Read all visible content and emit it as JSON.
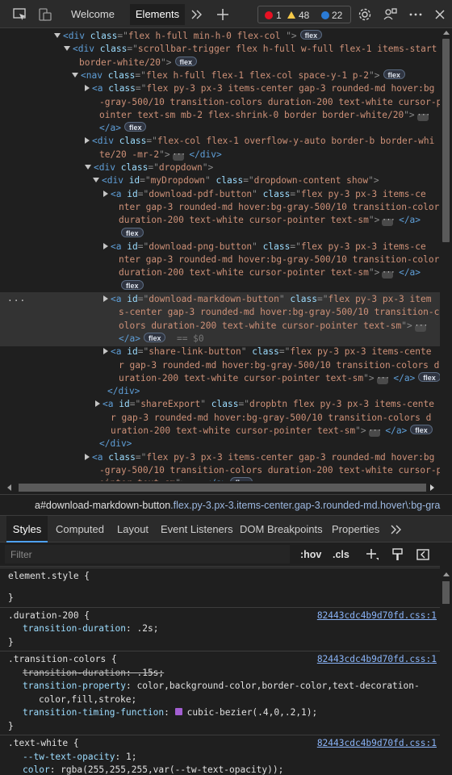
{
  "toolbar": {
    "tabs": [
      "Welcome",
      "Elements"
    ],
    "errors": "1",
    "warnings": "48",
    "issues": "22",
    "icons": [
      "inspect-icon",
      "device-toggle-icon",
      "more-tabs-icon",
      "add-tab-icon",
      "settings-icon",
      "customize-icon",
      "more-options-icon",
      "close-icon"
    ]
  },
  "tree": {
    "lines": [
      {
        "indent": 76,
        "arrow": "open",
        "parts": [
          [
            "tg",
            "<div "
          ],
          [
            "at",
            "class"
          ],
          [
            "pn",
            "=\""
          ],
          [
            "av",
            "flex h-full min-h-0 flex-col "
          ],
          [
            "pn",
            "\">"
          ]
        ],
        "badge": "flex"
      },
      {
        "indent": 88,
        "arrow": "open",
        "parts": [
          [
            "tg",
            "<div "
          ],
          [
            "at",
            "class"
          ],
          [
            "pn",
            "=\""
          ],
          [
            "av",
            "scrollbar-trigger flex h-full w-full flex-1 items-start"
          ]
        ]
      },
      {
        "indent": 98,
        "arrow": "",
        "parts": [
          [
            "av",
            "border-white/20"
          ],
          [
            "pn",
            "\">"
          ]
        ],
        "badge": "flex"
      },
      {
        "indent": 98,
        "arrow": "open",
        "parts": [
          [
            "tg",
            "<nav "
          ],
          [
            "at",
            "class"
          ],
          [
            "pn",
            "=\""
          ],
          [
            "av",
            "flex h-full flex-1 flex-col space-y-1 p-2"
          ],
          [
            "pn",
            "\">"
          ]
        ],
        "badge": "flex"
      },
      {
        "indent": 114,
        "arrow": "closed",
        "parts": [
          [
            "tg",
            "<a "
          ],
          [
            "at",
            "class"
          ],
          [
            "pn",
            "=\""
          ],
          [
            "av",
            "flex py-3 px-3 items-center gap-3 rounded-md hover:bg"
          ]
        ]
      },
      {
        "indent": 123,
        "arrow": "",
        "parts": [
          [
            "av",
            "-gray-500/10 transition-colors duration-200 text-white cursor-p"
          ]
        ]
      },
      {
        "indent": 123,
        "arrow": "",
        "parts": [
          [
            "av",
            "ointer text-sm mb-2 flex-shrink-0 border border-white/20"
          ],
          [
            "pn",
            "\">"
          ]
        ],
        "ell": true
      },
      {
        "indent": 123,
        "arrow": "",
        "parts": [
          [
            "tg",
            "</a>"
          ]
        ],
        "badge": "flex"
      },
      {
        "indent": 114,
        "arrow": "closed",
        "parts": [
          [
            "tg",
            "<div "
          ],
          [
            "at",
            "class"
          ],
          [
            "pn",
            "=\""
          ],
          [
            "av",
            "flex-col flex-1 overflow-y-auto border-b border-whi"
          ]
        ]
      },
      {
        "indent": 123,
        "arrow": "",
        "parts": [
          [
            "av",
            "te/20 -mr-2"
          ],
          [
            "pn",
            "\">"
          ]
        ],
        "ell": true,
        "after": [
          [
            "tg",
            "</div>"
          ]
        ]
      },
      {
        "indent": 114,
        "arrow": "open",
        "parts": [
          [
            "tg",
            "<div "
          ],
          [
            "at",
            "class"
          ],
          [
            "pn",
            "=\""
          ],
          [
            "av",
            "dropdown"
          ],
          [
            "pn",
            "\">"
          ]
        ]
      },
      {
        "indent": 124,
        "arrow": "open",
        "parts": [
          [
            "tg",
            "<div "
          ],
          [
            "at",
            "id"
          ],
          [
            "pn",
            "=\""
          ],
          [
            "av",
            "myDropdown"
          ],
          [
            "pn",
            "\" "
          ],
          [
            "at",
            "class"
          ],
          [
            "pn",
            "=\""
          ],
          [
            "av",
            "dropdown-content show"
          ],
          [
            "pn",
            "\">"
          ]
        ]
      },
      {
        "indent": 137,
        "arrow": "closed",
        "parts": [
          [
            "tg",
            "<a "
          ],
          [
            "at",
            "id"
          ],
          [
            "pn",
            "=\""
          ],
          [
            "av",
            "download-pdf-button"
          ],
          [
            "pn",
            "\" "
          ],
          [
            "at",
            "class"
          ],
          [
            "pn",
            "=\""
          ],
          [
            "av",
            "flex py-3 px-3 items-ce"
          ]
        ]
      },
      {
        "indent": 147,
        "arrow": "",
        "parts": [
          [
            "av",
            "nter gap-3 rounded-md hover:bg-gray-500/10 transition-colors"
          ]
        ]
      },
      {
        "indent": 147,
        "arrow": "",
        "parts": [
          [
            "av",
            "duration-200 text-white cursor-pointer text-sm"
          ],
          [
            "pn",
            "\">"
          ]
        ],
        "ell": true,
        "after": [
          [
            "tg",
            "</a>"
          ]
        ]
      },
      {
        "indent": 147,
        "arrow": "",
        "parts": [],
        "badge": "flex"
      },
      {
        "indent": 137,
        "arrow": "closed",
        "parts": [
          [
            "tg",
            "<a "
          ],
          [
            "at",
            "id"
          ],
          [
            "pn",
            "=\""
          ],
          [
            "av",
            "download-png-button"
          ],
          [
            "pn",
            "\" "
          ],
          [
            "at",
            "class"
          ],
          [
            "pn",
            "=\""
          ],
          [
            "av",
            "flex py-3 px-3 items-ce"
          ]
        ]
      },
      {
        "indent": 147,
        "arrow": "",
        "parts": [
          [
            "av",
            "nter gap-3 rounded-md hover:bg-gray-500/10 transition-colors"
          ]
        ]
      },
      {
        "indent": 147,
        "arrow": "",
        "parts": [
          [
            "av",
            "duration-200 text-white cursor-pointer text-sm"
          ],
          [
            "pn",
            "\">"
          ]
        ],
        "ell": true,
        "after": [
          [
            "tg",
            "</a>"
          ]
        ]
      },
      {
        "indent": 147,
        "arrow": "",
        "parts": [],
        "badge": "flex"
      },
      {
        "indent": 137,
        "arrow": "closed",
        "selected": true,
        "parts": [
          [
            "tg",
            "<a "
          ],
          [
            "at",
            "id"
          ],
          [
            "pn",
            "=\""
          ],
          [
            "av",
            "download-markdown-button"
          ],
          [
            "pn",
            "\" "
          ],
          [
            "at",
            "class"
          ],
          [
            "pn",
            "=\""
          ],
          [
            "av",
            "flex py-3 px-3 item"
          ]
        ]
      },
      {
        "indent": 147,
        "arrow": "",
        "selected": true,
        "parts": [
          [
            "av",
            "s-center gap-3 rounded-md hover:bg-gray-500/10 transition-c"
          ]
        ]
      },
      {
        "indent": 147,
        "arrow": "",
        "selected": true,
        "parts": [
          [
            "av",
            "olors duration-200 text-white cursor-pointer text-sm"
          ],
          [
            "pn",
            "\">"
          ]
        ],
        "ell": true
      },
      {
        "indent": 147,
        "arrow": "",
        "selected": true,
        "parts": [
          [
            "tg",
            "</a>"
          ]
        ],
        "badge": "flex",
        "after": [
          [
            "dollar",
            " == $0"
          ]
        ]
      },
      {
        "indent": 137,
        "arrow": "closed",
        "parts": [
          [
            "tg",
            "<a "
          ],
          [
            "at",
            "id"
          ],
          [
            "pn",
            "=\""
          ],
          [
            "av",
            "share-link-button"
          ],
          [
            "pn",
            "\" "
          ],
          [
            "at",
            "class"
          ],
          [
            "pn",
            "=\""
          ],
          [
            "av",
            "flex py-3 px-3 items-cente"
          ]
        ]
      },
      {
        "indent": 147,
        "arrow": "",
        "parts": [
          [
            "av",
            "r gap-3 rounded-md hover:bg-gray-500/10 transition-colors d"
          ]
        ]
      },
      {
        "indent": 147,
        "arrow": "",
        "parts": [
          [
            "av",
            "uration-200 text-white cursor-pointer text-sm"
          ],
          [
            "pn",
            "\">"
          ]
        ],
        "ell": true,
        "after": [
          [
            "tg",
            "</a>"
          ]
        ],
        "badge2": "flex"
      },
      {
        "indent": 133,
        "arrow": "",
        "parts": [
          [
            "tg",
            "</div>"
          ]
        ]
      },
      {
        "indent": 127,
        "arrow": "closed",
        "parts": [
          [
            "tg",
            "<a "
          ],
          [
            "at",
            "id"
          ],
          [
            "pn",
            "=\""
          ],
          [
            "av",
            "shareExport"
          ],
          [
            "pn",
            "\" "
          ],
          [
            "at",
            "class"
          ],
          [
            "pn",
            "=\""
          ],
          [
            "av",
            "dropbtn flex py-3 px-3 items-cente"
          ]
        ]
      },
      {
        "indent": 137,
        "arrow": "",
        "parts": [
          [
            "av",
            "r gap-3 rounded-md hover:bg-gray-500/10 transition-colors d"
          ]
        ]
      },
      {
        "indent": 137,
        "arrow": "",
        "parts": [
          [
            "av",
            "uration-200 text-white cursor-pointer text-sm"
          ],
          [
            "pn",
            "\">"
          ]
        ],
        "ell": true,
        "after": [
          [
            "tg",
            "</a>"
          ]
        ],
        "badge2": "flex"
      },
      {
        "indent": 123,
        "arrow": "",
        "parts": [
          [
            "tg",
            "</div>"
          ]
        ]
      },
      {
        "indent": 114,
        "arrow": "closed",
        "parts": [
          [
            "tg",
            "<a "
          ],
          [
            "at",
            "class"
          ],
          [
            "pn",
            "=\""
          ],
          [
            "av",
            "flex py-3 px-3 items-center gap-3 rounded-md hover:bg"
          ]
        ]
      },
      {
        "indent": 123,
        "arrow": "",
        "parts": [
          [
            "av",
            "-gray-500/10 transition-colors duration-200 text-white cursor-p"
          ]
        ]
      },
      {
        "indent": 123,
        "arrow": "",
        "parts": [
          [
            "av",
            "ointer text-sm"
          ],
          [
            "pn",
            "\">"
          ]
        ],
        "ell": true,
        "after": [
          [
            "tg",
            "</a>"
          ]
        ],
        "badge2": "flex"
      }
    ]
  },
  "breadcrumb": {
    "main": "a#download-markdown-button",
    "classes": ".flex.py-3.px-3.items-center.gap-3.rounded-md.hover\\:bg-gra"
  },
  "styles_tabs": [
    "Styles",
    "Computed",
    "Layout",
    "Event Listeners",
    "DOM Breakpoints",
    "Properties"
  ],
  "filter": {
    "placeholder": "Filter",
    "hov": ":hov",
    "cls": ".cls"
  },
  "rules": [
    {
      "selector": "element.style {",
      "source": "",
      "decls": [],
      "close": "}"
    },
    {
      "selector": ".duration-200 {",
      "source": "82443cdc4b9d70fd.css:1",
      "decls": [
        {
          "p": "transition-duration",
          "v": ".2s"
        }
      ],
      "close": "}"
    },
    {
      "selector": ".transition-colors {",
      "source": "82443cdc4b9d70fd.css:1",
      "decls": [
        {
          "p": "transition-duration",
          "v": ".15s",
          "strike": true
        },
        {
          "p": "transition-property",
          "v": "color,background-color,border-color,text-decoration-",
          "cont": "color,fill,stroke"
        },
        {
          "p": "transition-timing-function",
          "v": "cubic-bezier(.4,0,.2,1)",
          "bezier": true
        }
      ],
      "close": "}"
    },
    {
      "selector": ".text-white {",
      "source": "82443cdc4b9d70fd.css:1",
      "decls": [
        {
          "p": "--tw-text-opacity",
          "v": "1"
        },
        {
          "p": "color",
          "v": "rgba(255,255,255,var(--tw-text-opacity))"
        }
      ],
      "close": ""
    }
  ]
}
